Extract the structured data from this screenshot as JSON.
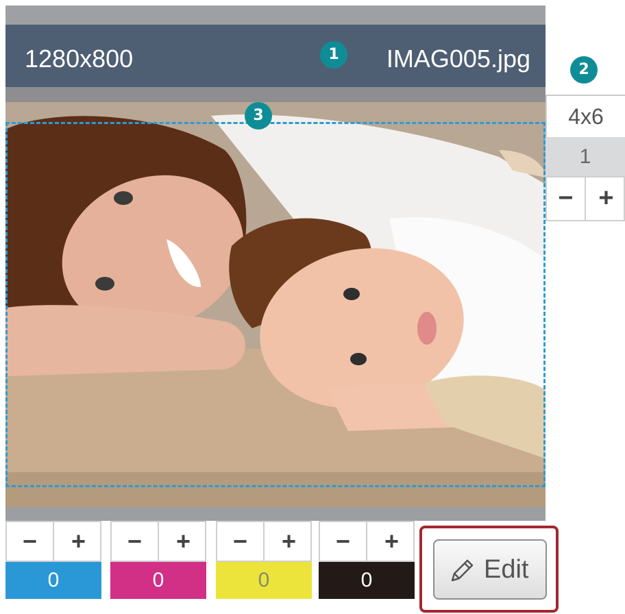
{
  "header": {
    "resolution": "1280x800",
    "filename": "IMAG005.jpg",
    "badge": "1"
  },
  "photo": {
    "badge": "3",
    "description_icon": "photo-preview"
  },
  "side_panel": {
    "badge": "2",
    "print_size": "4x6",
    "copies": "1",
    "minus_label": "−",
    "plus_label": "+"
  },
  "color_adjust": [
    {
      "name": "cyan",
      "value": "0",
      "color": "#2a98d6",
      "text_color": "#ffffff",
      "minus_label": "−",
      "plus_label": "+"
    },
    {
      "name": "magenta",
      "value": "0",
      "color": "#d22f86",
      "text_color": "#ffffff",
      "minus_label": "−",
      "plus_label": "+"
    },
    {
      "name": "yellow",
      "value": "0",
      "color": "#ece43b",
      "text_color": "#8a8a6a",
      "minus_label": "−",
      "plus_label": "+"
    },
    {
      "name": "black",
      "value": "0",
      "color": "#231a17",
      "text_color": "#ffffff",
      "minus_label": "−",
      "plus_label": "+"
    }
  ],
  "edit": {
    "label": "Edit",
    "icon": "pencil-icon",
    "highlight_color": "#a3282f"
  },
  "colors": {
    "header_bg": "#4e5f74",
    "badge_bg": "#0f8d97",
    "crop_dash": "#2a9bd4"
  }
}
